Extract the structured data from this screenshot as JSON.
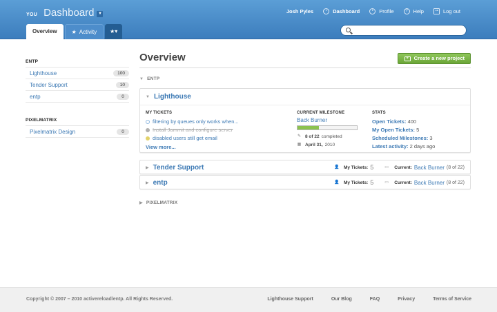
{
  "header": {
    "brand_prefix": "YOU",
    "brand_title": "Dashboard",
    "nav": [
      {
        "label": "Josh Pyles"
      },
      {
        "label": "Dashboard"
      },
      {
        "label": "Profile"
      },
      {
        "label": "Help"
      },
      {
        "label": "Log out"
      }
    ],
    "tabs": [
      {
        "label": "Overview"
      },
      {
        "label": "Activity"
      }
    ]
  },
  "sidebar": {
    "groups": [
      {
        "title": "ENTP",
        "items": [
          {
            "name": "Lighthouse",
            "count": "100"
          },
          {
            "name": "Tender Support",
            "count": "10"
          },
          {
            "name": "entp",
            "count": "0"
          }
        ]
      },
      {
        "title": "PIXELMATRIX",
        "items": [
          {
            "name": "Pixelmatrix Design",
            "count": "0"
          }
        ]
      }
    ]
  },
  "main": {
    "title": "Overview",
    "create_button": "Create a new project",
    "groups": [
      {
        "label": "ENTP"
      },
      {
        "label": "PIXELMATRIX"
      }
    ],
    "lighthouse": {
      "name": "Lighthouse",
      "my_tickets_label": "MY TICKETS",
      "tickets": [
        {
          "text": "filtering by queues only works when...",
          "color": "#8fb8e0",
          "done": false
        },
        {
          "text": "Install Jammit and configure server",
          "color": "#b0b0b0",
          "done": true
        },
        {
          "text": "disabled users still get email",
          "color": "#e2d26a",
          "done": false
        }
      ],
      "view_more": "View more...",
      "milestone_label": "CURRENT MILESTONE",
      "milestone_name": "Back Burner",
      "milestone_progress": 0.36,
      "milestone_completed": "8 of 22",
      "milestone_completed_suffix": "completed",
      "milestone_date": "April 31,",
      "milestone_year": "2010",
      "stats_label": "STATS",
      "stats": [
        {
          "k": "Open Tickets:",
          "v": "400"
        },
        {
          "k": "My Open Tickets:",
          "v": "5"
        },
        {
          "k": "Scheduled Milestones:",
          "v": "3"
        },
        {
          "k": "Latest activity:",
          "v": "2 days ago"
        }
      ]
    },
    "collapsed": [
      {
        "name": "Tender Support",
        "my_tickets_label": "My Tickets:",
        "my_tickets": "5",
        "current_label": "Current:",
        "current": "Back Burner",
        "current_count": "(8 of 22)"
      },
      {
        "name": "entp",
        "my_tickets_label": "My Tickets:",
        "my_tickets": "5",
        "current_label": "Current:",
        "current": "Back Burner",
        "current_count": "(8 of 22)"
      }
    ]
  },
  "footer": {
    "copyright": "Copyright © 2007 – 2010 activereload/entp. All Rights Reserved.",
    "links": [
      {
        "label": "Lighthouse Support"
      },
      {
        "label": "Our Blog"
      },
      {
        "label": "FAQ"
      },
      {
        "label": "Privacy"
      },
      {
        "label": "Terms of Service"
      }
    ]
  }
}
